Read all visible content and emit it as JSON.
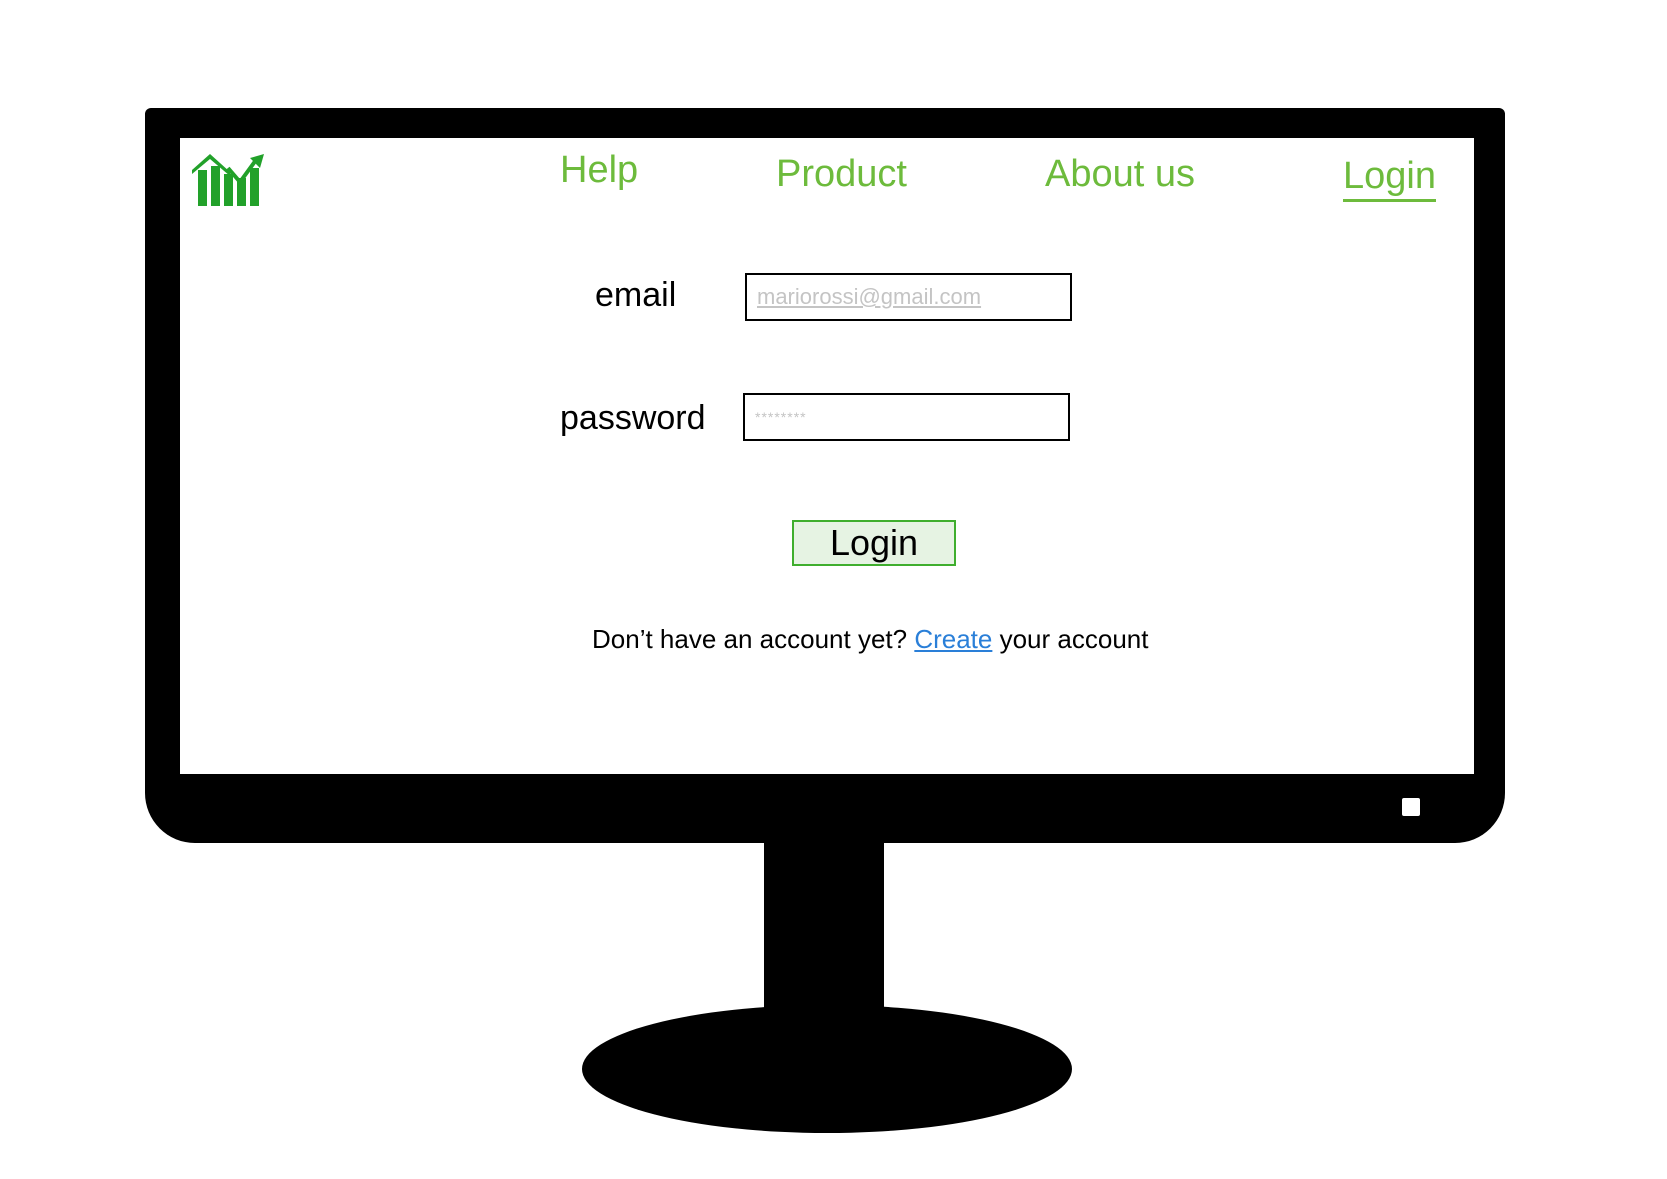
{
  "nav": {
    "help": "Help",
    "product": "Product",
    "about": "About us",
    "login": "Login"
  },
  "form": {
    "email_label": "email",
    "email_placeholder": "mariorossi@gmail.com",
    "password_label": "password",
    "password_placeholder": "********",
    "login_button": "Login"
  },
  "signup": {
    "prefix": "Don’t have an account yet? ",
    "link": "Create",
    "suffix": " your account"
  },
  "colors": {
    "nav_green": "#6dbb3c",
    "logo_green": "#22a12a",
    "button_border": "#3fae2e",
    "button_fill": "#e6f3e3",
    "link_blue": "#2a7fd8"
  },
  "icons": {
    "logo": "bar-chart-house-icon"
  }
}
